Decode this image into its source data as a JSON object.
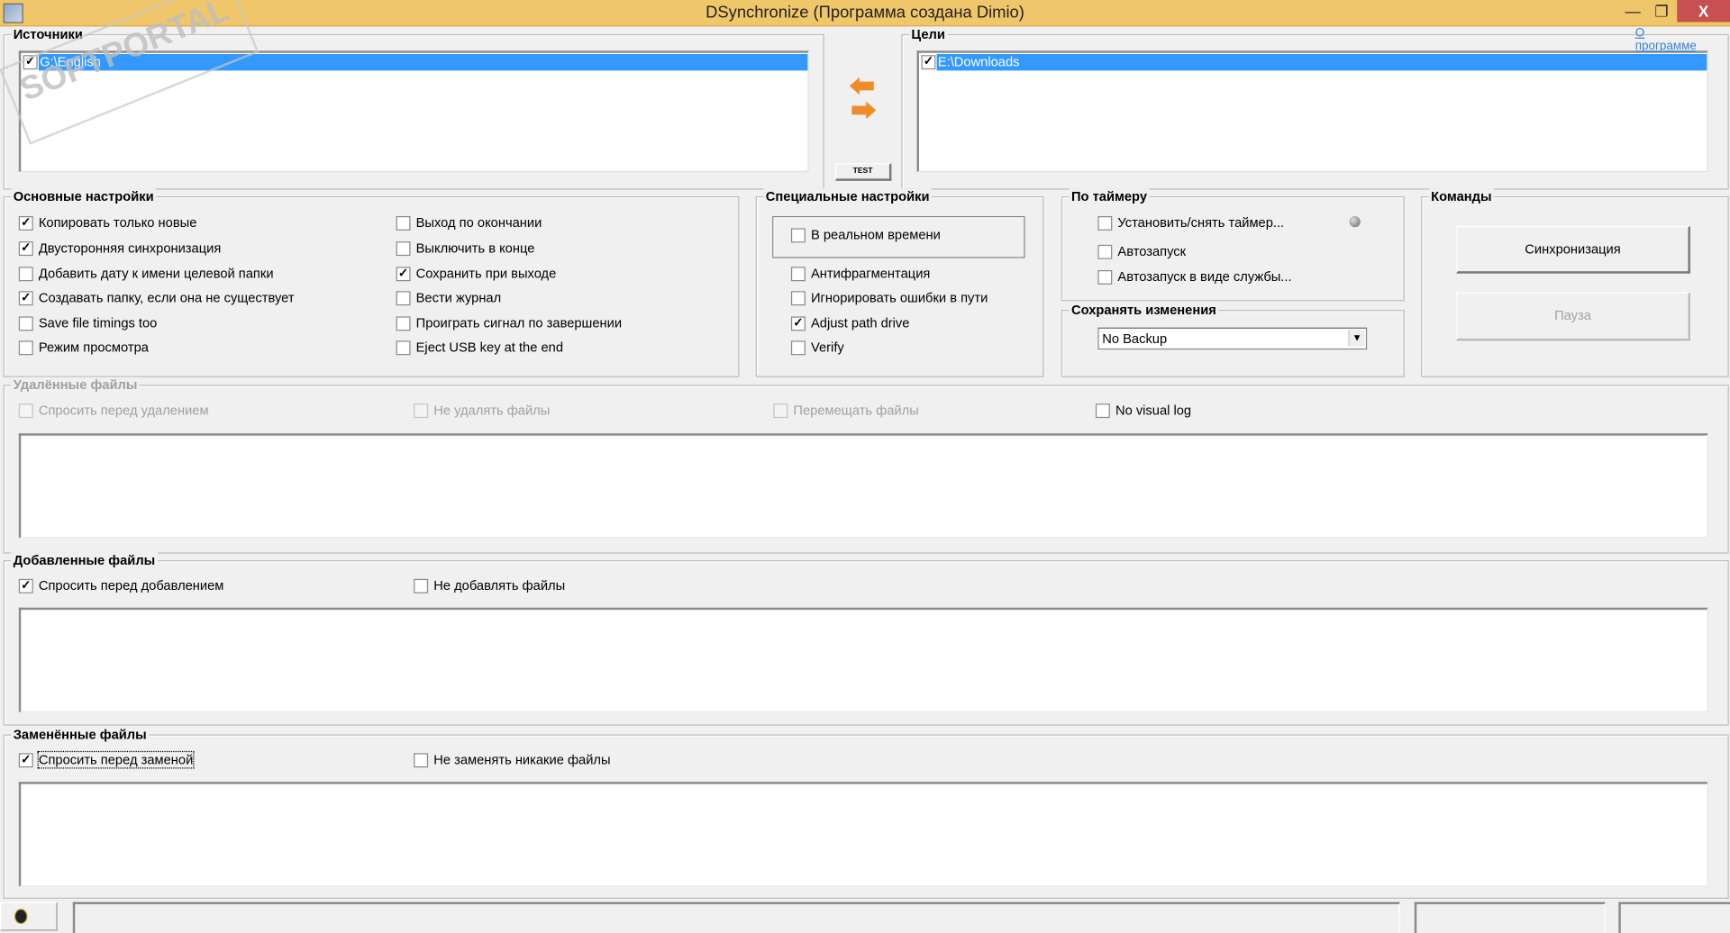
{
  "window": {
    "title": "DSynchronize (Программа создана Dimio)",
    "minimize": "—",
    "maximize": "❐",
    "close": "X",
    "watermark": "SOFTPORTAL www.softportal.com"
  },
  "sources": {
    "legend": "Источники",
    "items": [
      {
        "path": "G:\\English",
        "checked": true
      }
    ]
  },
  "targets": {
    "legend": "Цели",
    "items": [
      {
        "path": "E:\\Downloads",
        "checked": true
      }
    ],
    "about_link_1": "О",
    "about_link_2": "программе"
  },
  "middle": {
    "test_button": "TEST"
  },
  "basic": {
    "legend": "Основные настройки",
    "items": [
      {
        "label": "Копировать только новые",
        "checked": true
      },
      {
        "label": "Двусторонняя синхронизация",
        "checked": true
      },
      {
        "label": "Добавить дату к имени целевой папки",
        "checked": false
      },
      {
        "label": "Создавать папку, если она не существует",
        "checked": true
      },
      {
        "label": "Save file timings too",
        "checked": false
      },
      {
        "label": "Режим просмотра",
        "checked": false
      },
      {
        "label": "Выход по окончании",
        "checked": false
      },
      {
        "label": "Выключить в конце",
        "checked": false
      },
      {
        "label": "Сохранить при выходе",
        "checked": true
      },
      {
        "label": "Вести журнал",
        "checked": false
      },
      {
        "label": "Проиграть сигнал по завершении",
        "checked": false
      },
      {
        "label": "Eject USB key at the end",
        "checked": false
      }
    ]
  },
  "special": {
    "legend": "Специальные настройки",
    "items": [
      {
        "label": "В реальном времени",
        "checked": false
      },
      {
        "label": "Антифрагментация",
        "checked": false
      },
      {
        "label": "Игнорировать ошибки в пути",
        "checked": false
      },
      {
        "label": "Adjust path drive",
        "checked": true
      },
      {
        "label": "Verify",
        "checked": false
      }
    ]
  },
  "timer": {
    "legend": "По таймеру",
    "items": [
      {
        "label": "Установить/снять таймер...",
        "checked": false
      },
      {
        "label": "Автозапуск",
        "checked": false
      },
      {
        "label": "Автозапуск в виде службы...",
        "checked": false
      }
    ]
  },
  "save_changes": {
    "legend": "Сохранять изменения",
    "selected": "No Backup"
  },
  "commands": {
    "legend": "Команды",
    "sync": "Синхронизация",
    "pause": "Пауза"
  },
  "deleted": {
    "legend": "Удалённые файлы",
    "items": [
      {
        "label": "Спросить перед удалением",
        "checked": false
      },
      {
        "label": "Не удалять файлы",
        "checked": false
      },
      {
        "label": "Перемещать файлы",
        "checked": false
      },
      {
        "label": "No visual log",
        "checked": false
      }
    ]
  },
  "added": {
    "legend": "Добавленные файлы",
    "items": [
      {
        "label": "Спросить перед добавлением",
        "checked": true
      },
      {
        "label": "Не добавлять файлы",
        "checked": false
      }
    ]
  },
  "replaced": {
    "legend": "Заменённые файлы",
    "items": [
      {
        "label": "Спросить перед заменой",
        "checked": true
      },
      {
        "label": "Не заменять никакие файлы",
        "checked": false
      }
    ]
  }
}
